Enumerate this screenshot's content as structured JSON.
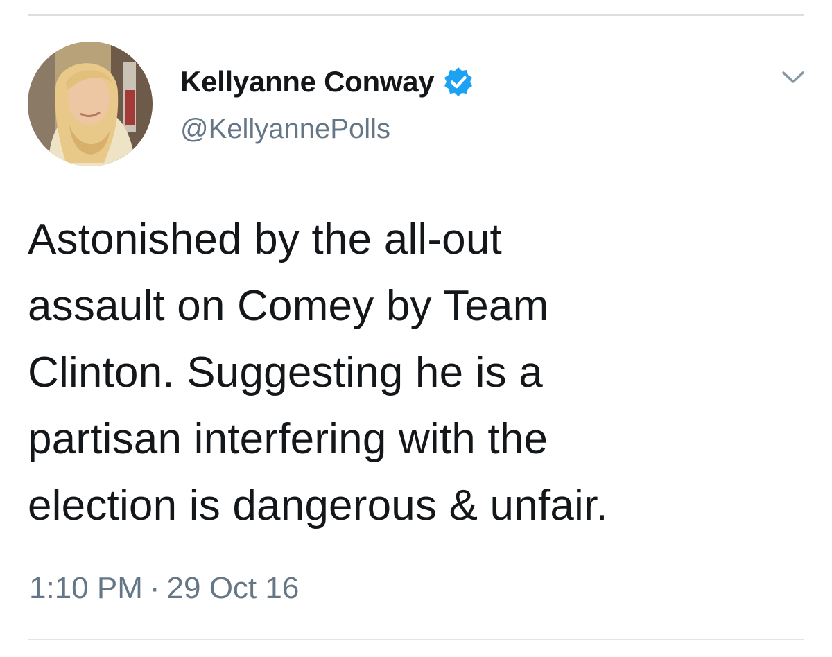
{
  "tweet": {
    "author": {
      "display_name": "Kellyanne Conway",
      "handle": "@KellyannePolls",
      "verified": true,
      "avatar": "profile-photo"
    },
    "text_lines": [
      "Astonished by the all-out",
      "assault on Comey by Team",
      "Clinton. Suggesting he is a",
      "partisan interfering with the",
      "election is dangerous & unfair."
    ],
    "time": "1:10 PM",
    "separator": "·",
    "date": "29 Oct 16",
    "menu_icon": "chevron-down-icon"
  },
  "colors": {
    "text_primary": "#14171a",
    "text_secondary": "#657786",
    "verified_blue": "#1da1f2",
    "divider": "#dcdfe2"
  }
}
